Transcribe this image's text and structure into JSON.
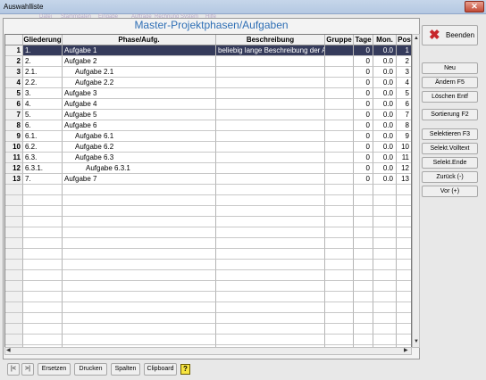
{
  "window": {
    "title": "Auswahlliste",
    "close_symbol": "✕"
  },
  "menu": [
    "Datei",
    "Stammdaten",
    "Eingabe",
    "Aufträge",
    "Rechnung",
    "System",
    "Hilfe"
  ],
  "caption": "Master-Projektphasen/Aufgaben",
  "table": {
    "columns": [
      "Gliederung",
      "Phase/Aufg.",
      "Beschreibung",
      "Gruppe",
      "Tage",
      "Mon.",
      "Pos"
    ],
    "rows": [
      [
        "1",
        "1.",
        "Aufgabe 1",
        "beliebig lange Beschreibung der Au",
        "",
        "0",
        "0.0",
        "1"
      ],
      [
        "2",
        "2.",
        "Aufgabe 2",
        "",
        "",
        "0",
        "0.0",
        "2"
      ],
      [
        "3",
        "2.1.",
        "Aufgabe 2.1",
        "",
        "",
        "0",
        "0.0",
        "3"
      ],
      [
        "4",
        "2.2.",
        "Aufgabe 2.2",
        "",
        "",
        "0",
        "0.0",
        "4"
      ],
      [
        "5",
        "3.",
        "Aufgabe 3",
        "",
        "",
        "0",
        "0.0",
        "5"
      ],
      [
        "6",
        "4.",
        "Aufgabe 4",
        "",
        "",
        "0",
        "0.0",
        "6"
      ],
      [
        "7",
        "5.",
        "Aufgabe 5",
        "",
        "",
        "0",
        "0.0",
        "7"
      ],
      [
        "8",
        "6.",
        "Aufgabe 6",
        "",
        "",
        "0",
        "0.0",
        "8"
      ],
      [
        "9",
        "6.1.",
        "Aufgabe 6.1",
        "",
        "",
        "0",
        "0.0",
        "9"
      ],
      [
        "10",
        "6.2.",
        "Aufgabe 6.2",
        "",
        "",
        "0",
        "0.0",
        "10"
      ],
      [
        "11",
        "6.3.",
        "Aufgabe 6.3",
        "",
        "",
        "0",
        "0.0",
        "11"
      ],
      [
        "12",
        "6.3.1.",
        "Aufgabe 6.3.1",
        "",
        "",
        "0",
        "0.0",
        "12"
      ],
      [
        "13",
        "7.",
        "Aufgabe 7",
        "",
        "",
        "0",
        "0.0",
        "13"
      ]
    ],
    "indent_levels": [
      0,
      0,
      1,
      1,
      0,
      0,
      0,
      0,
      1,
      1,
      1,
      2,
      0
    ],
    "selected_row": 1
  },
  "buttons": {
    "beenden": "Beenden",
    "neu": "Neu",
    "aendern": "Ändern  F5",
    "loeschen": "Löschen  Entf",
    "sortierung": "Sortierung F2",
    "selektieren": "Selektieren  F3",
    "volltext": "Selekt.Volltext",
    "ende": "Selekt.Ende",
    "zurueck": "Zurück (-)",
    "vor": "Vor   (+)"
  },
  "footer": {
    "first": "|<",
    "last": ">|",
    "ersetzen": "Ersetzen",
    "drucken": "Drucken",
    "spalten": "Spalten",
    "clipboard": "Clipboard",
    "help": "?"
  }
}
